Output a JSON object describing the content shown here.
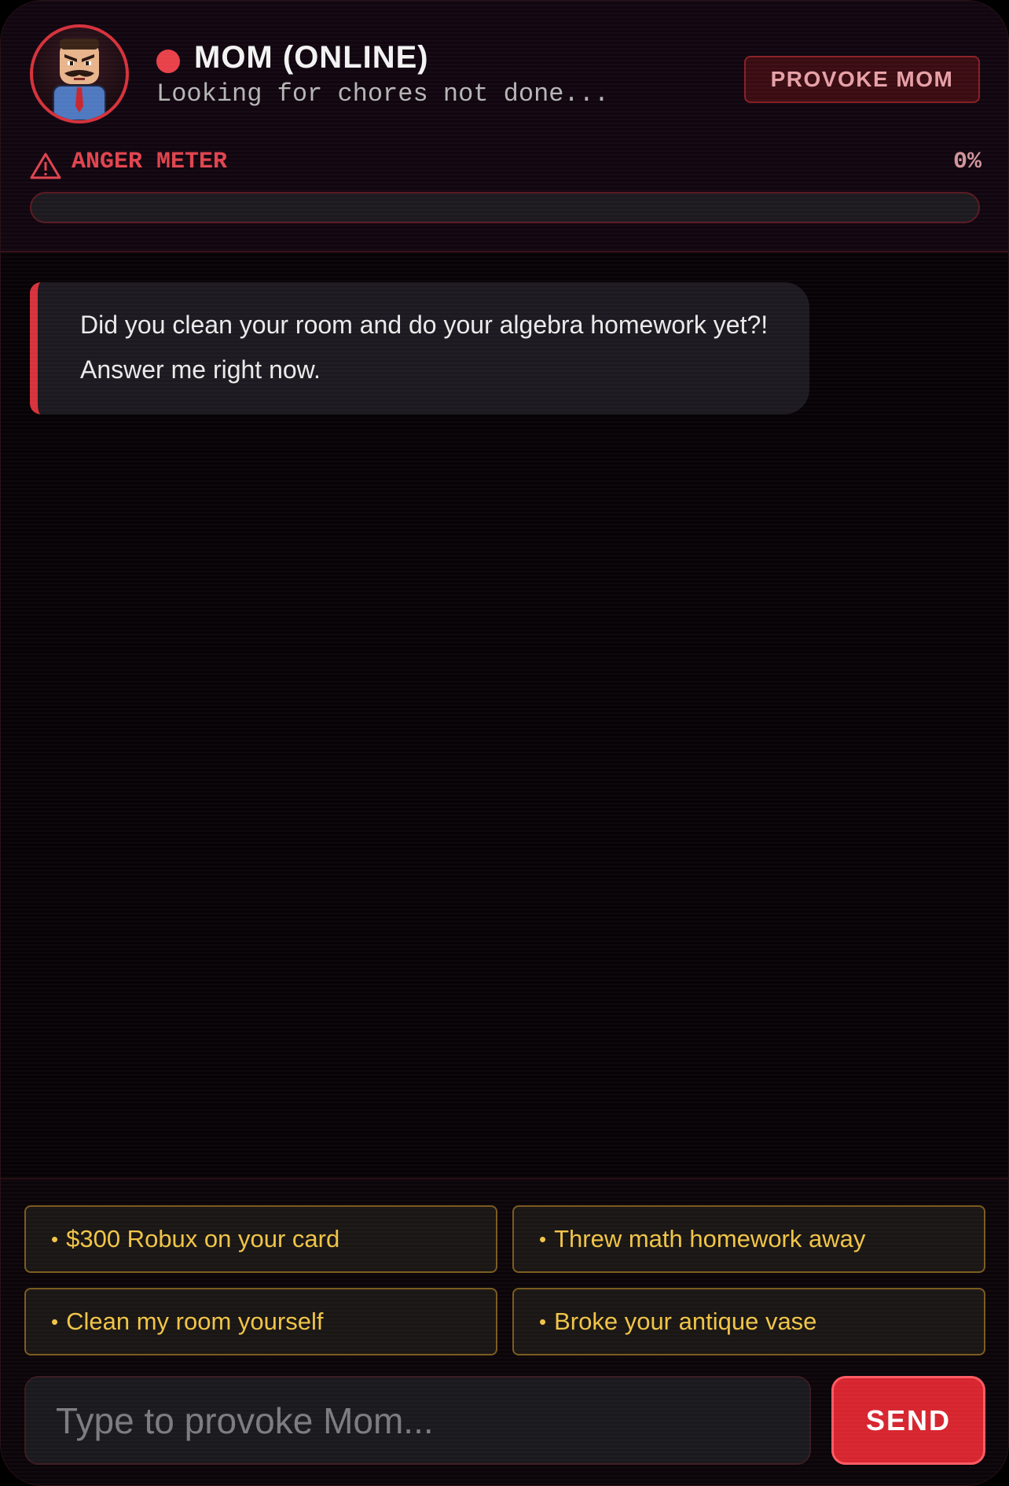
{
  "header": {
    "name": "MOM (ONLINE)",
    "status": "Looking for chores not done...",
    "provoke_label": "PROVOKE MOM",
    "avatar_icon": "angry-dad-pixel-avatar"
  },
  "anger": {
    "label": "ANGER METER",
    "value_text": "0%",
    "level": 0,
    "icon": "warning-triangle-icon"
  },
  "chat": {
    "messages": [
      {
        "sender": "mom",
        "text": "Did you clean your room and do your algebra homework yet?! Answer me right now."
      }
    ]
  },
  "quick_replies": [
    {
      "label": "$300 Robux on your card"
    },
    {
      "label": "Threw math homework away"
    },
    {
      "label": "Clean my room yourself"
    },
    {
      "label": "Broke your antique vase"
    }
  ],
  "composer": {
    "placeholder": "Type to provoke Mom...",
    "send_label": "SEND"
  },
  "colors": {
    "accent": "#d6323c",
    "quick_text": "#f0c447",
    "background": "#070306"
  }
}
